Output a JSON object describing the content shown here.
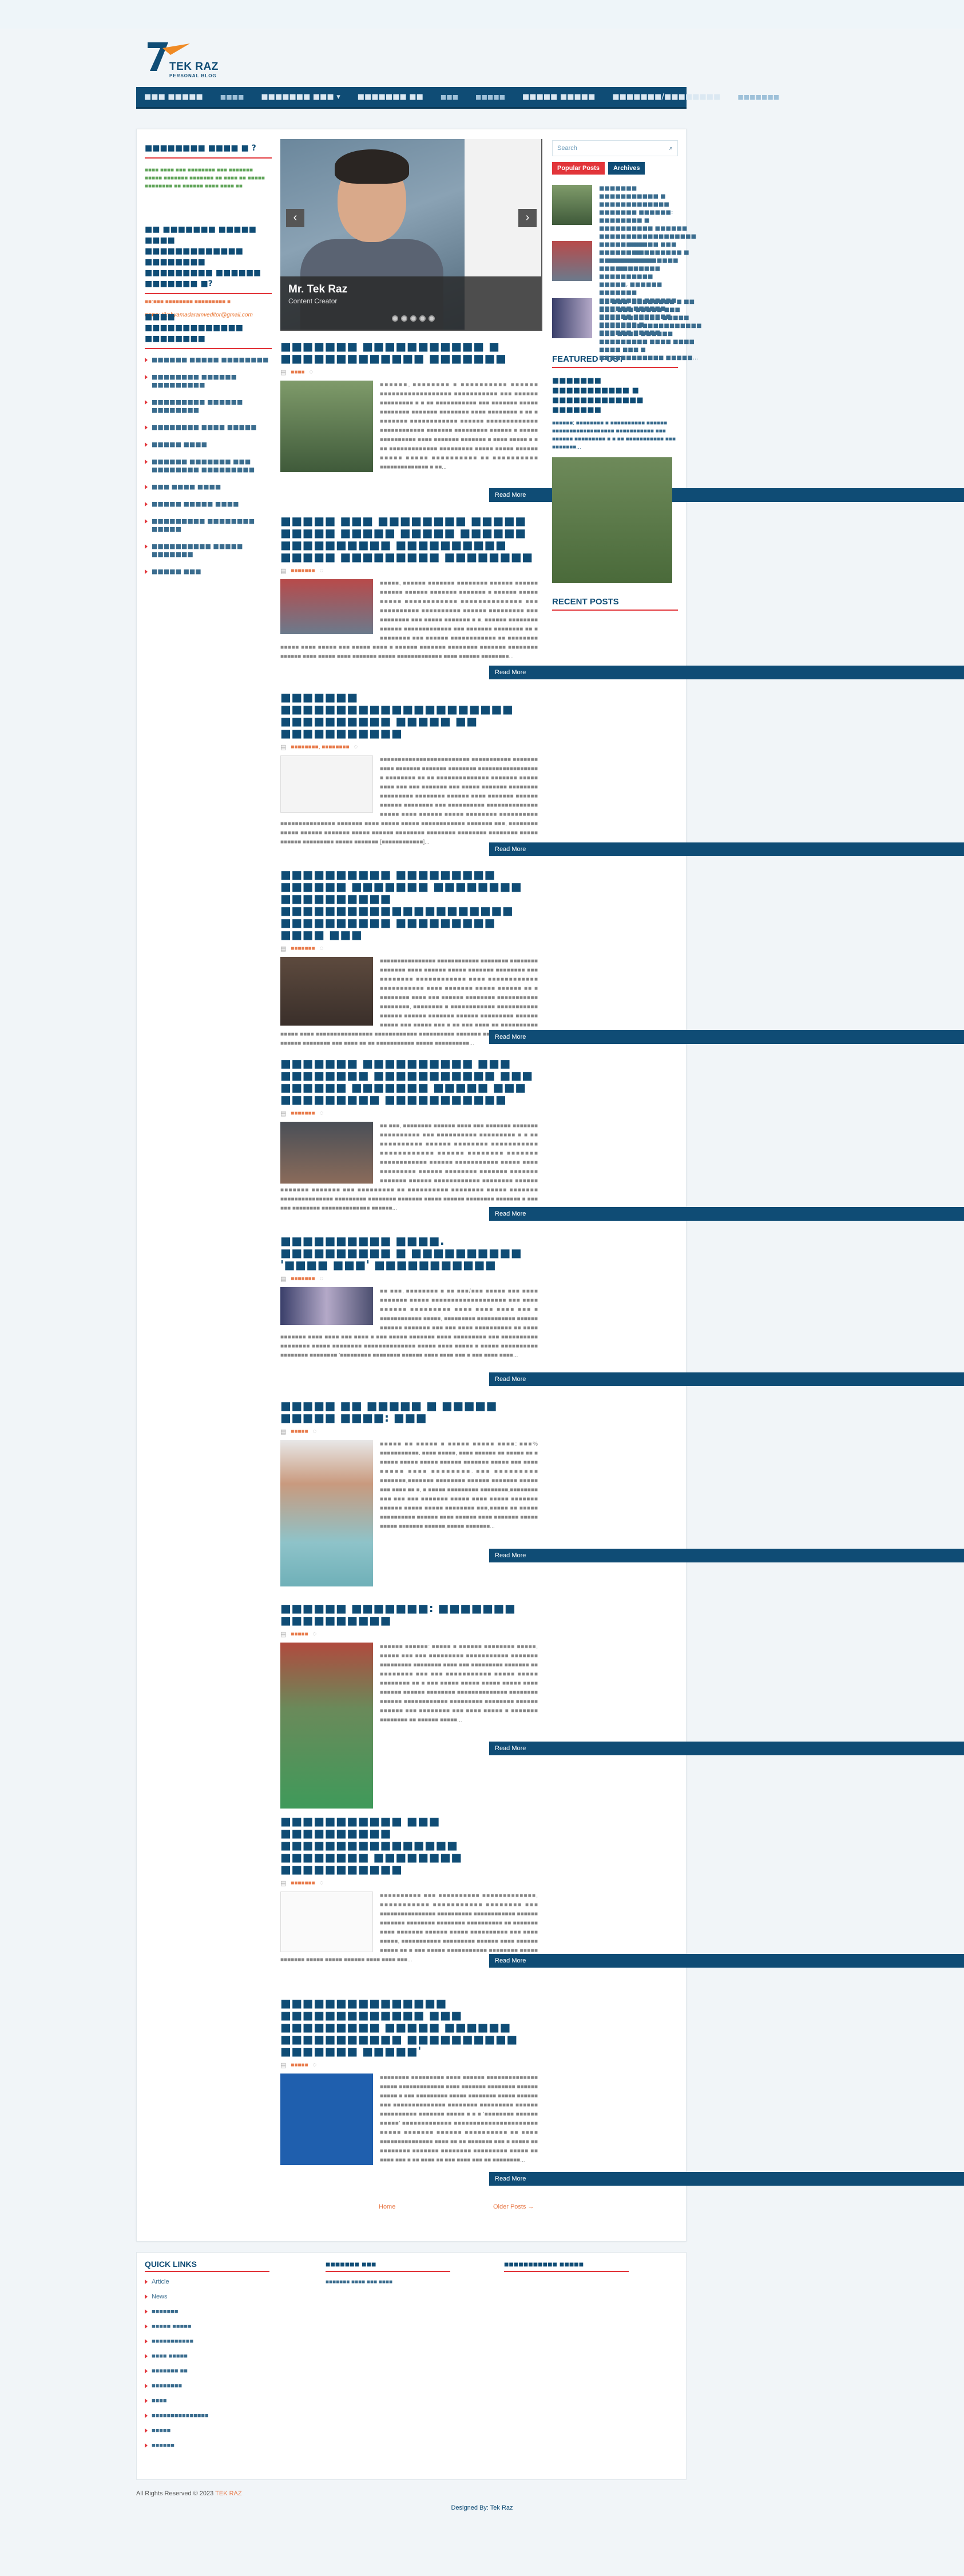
{
  "header": {
    "brand": "TEK RAZ",
    "tagline": "PERSONAL BLOG"
  },
  "nav": {
    "items": [
      "■■■ ■■■■■",
      "■■■■",
      "■■■■■■■ ■■■ ▾",
      "■■■■■■■ ■■",
      "■■■",
      "■■■■■",
      "■■■■■ ■■■■■",
      "■■■■■■■/■■■■■■■■",
      "■■■■■■■"
    ]
  },
  "left_sidebar": {
    "about_title": "■■■■■■■■ ■■■■ ■ ?",
    "about_text": "■■■■ ■■■■ ■■■ ■■■■■■■■ ■■■ ■■■■■■■ ■■■■■ ■■■■■■■ ■■■■■■■ ■■ ■■■■ ■■ ■■■■■ ■■■■■■■■ ■■ ■■■■■■ ■■■■ ■■■■ ■■",
    "contact_title": "■■ ■■■■■■■ ■■■■■ ■■■■ ■■■■■■■■■■■■■ ■■■■■■■■ ■■■■■■■■■ ■■■■■■ ■■■■■■■ ■?",
    "contact_phone": "■■:■■■ ■■■■■■■■ ■■■■■■■■■ ■",
    "contact_email": "■■■■: tikshyamadaramveditor@gmail.com",
    "categories_title": "■■■■ ■■■■■■■■■■■■■ ■■■■■■■■",
    "categories": [
      "■■■■■■ ■■■■■ ■■■■■■■■",
      "■■■■■■■■ ■■■■■■ ■■■■■■■■■",
      "■■■■■■■■■ ■■■■■■ ■■■■■■■■",
      "■■■■■■■■ ■■■■ ■■■■■",
      "■■■■■ ■■■■",
      "■■■■■■ ■■■■■■■ ■■■ ■■■■■■■■ ■■■■■■■■■",
      "■■■ ■■■■ ■■■■",
      "■■■■■ ■■■■■ ■■■■",
      "■■■■■■■■■ ■■■■■■■■ ■■■■■",
      "■■■■■■■■■■ ■■■■■ ■■■■■■■",
      "■■■■■ ■■■"
    ]
  },
  "slider": {
    "title": "Mr. Tek Raz",
    "subtitle": "Content Creator"
  },
  "posts": [
    {
      "title": "■■■■■■■ ■■■■■■■■■■■ ■ ■■■■■■■■■■■■■ ■■■■■■■",
      "cat": "■■■■",
      "text": "■■■■■■, ■■■■■■■■ ■ ■■■■■■■■■■ ■■■■■■ ■■■■■■■■■■■■■■■■■■ ■■■■■■■■■■■ ■■■ ■■■■■■ ■■■■■■■■■ ■ ■ ■■ ■■■■■■■■■■■ ■■■ ■■■■■■■ ■■■■■ ■■■■■■■■ ■■■■■■■ ■■■■■■■■ ■■■■ ■■■■■■■■ ■ ■■ ■ ■■■■■■■ ■■■■■■■■■■■■ ■■■■■■ ■■■■■■■■■■■■■ ■■■■■■■■■■■■ ■■■■■■■ ■■■■■■■■■ ■■■■■■ ■ ■■■■■ ■■■■■■■■■■ ■■■■ ■■■■■■■ ■■■■■■■ ■ ■■■■ ■■■■■ ■ ■ ■■ ■■■■■■■■■■■■■ ■■■■■■■■■ ■■■■■ ■■■■■ ■■■■■■ ■■■■■ ■■■■■ ■■■■■■■■■■ ■■ ■■■■■■■■■■ ■■■■■■■■■■■■■■ ■ ■■...",
      "read_more": "Read More"
    },
    {
      "title": "■■■■■ ■■■ ■■■■■■■■ ■■■■■ ■■■■■ ■■■■■ ■■■■■ ■■■■■■ ■■■■■■■■■■ ■■■■■■■■■■ ■■■■■ ■■■■■■■■■ ■■■■■■■■",
      "cat": "■■■■■■■",
      "text": "■■■■■, ■■■■■■ ■■■■■■■ ■■■■■■■■ ■■■■■■ ■■■■■■ ■■■■■■ ■■■■■■ ■■■■■■■ ■■■■■■■ ■ ■■■■■■ ■■■■■ ■■■■■ ■■■■■■■■■■■■ ■■■■■■■■■■■■■■ ■■■ ■■■■■■■■■■ ■■■■■■■■■■ ■■■■■■ ■■■■■■■■■ ■■■ ■■■■■■■■ ■■■ ■■■■■ ■■■■■■■ ■ ■. ■■■■■■ ■■■■■■■■ ■■■■■■ ■■■■■■■■■■■■■ ■■■ ■■■■■■■ ■■■■■■■■ ■■ ■ ■■■■■■■■ ■■■ ■■■■■■ ■■■■■■■■■■■■ ■■ ■■■■■■■■ ■■■■■ ■■■■ ■■■■■ ■■■ ■■■■■ ■■■■ ■ ■■■■■■ ■■■■■■■ ■■■■■■■■ ■■■■■■■ ■■■■■■■■ ■■■■■■ ■■■■ ■■■■■ ■■■■ ■■■■■■■ ■■■■■ ■■■■■■■■■■■■■ ■■■■ ■■■■■■ ■■■■■■■■...",
      "read_more": "Read More"
    },
    {
      "title": "■■■■■■■ ■■■■■■■■■■■■■■■■■■■■■ ■■■■■■■■■■ ■■■■■ ■■ ■■■■■■■■■■■",
      "cat": "■■■■■■■■, ■■■■■■■■",
      "text": "■■■■■■■■■■■■■■■■■■■■■■■■■ ■■■■■■■■■■■ ■■■■■■■ ■■■■ ■■■■■■■ ■■■■■■■ ■■■■■■■■ ■■■■■■■■■■■■■■■■■ ■ ■■■■■■■■ ■■ ■■ ■■■■■■■■■■■■■■ ■■■■■■■ ■■■■■ ■■■■ ■■■ ■■■ ■■■■■■■ ■■■ ■■■■■ ■■■■■■■ ■■■■■■■■ ■■■■■■■■■ ■■■■■■■■ ■■■■■■ ■■■■ ■■■■■■■ ■■■■■■ ■■■■■■ ■■■■■■■■ ■■■ ■■■■■■■■■■ ■■■■■■■■■■■■■■ ■■■■■ ■■■■ ■■■■■■ ■■■■■ ■■■■■■■■ ■■■■■■■■■■ ■■■■■■■■■■■■■■■ ■■■■■■■ ■■■■ ■■■■■ ■■■■■ ■■■■■■■■■■■■ ■■■■■■■ ■■■, ■■■■■■■■ ■■■■■ ■■■■■■ ■■■■■■■ ■■■■■ ■■■■■■ ■■■■■■■■ ■■■■■■■■ ■■■■■■■■ ■■■■■■■■ ■■■■■ ■■■■■■ ■■■■■■■■■ ■■■■■ ■■■■■■■ [■■■■■■■■■■■■]...",
      "read_more": "Read More"
    },
    {
      "title": "■■■■■■■■■■ ■■■■■■■■■ ■■■■■■ ■■■■■■■ ■■■■■■■■ ■■■■■■■■■■ ■■■■■■■■■■■■■■■■■■■■■ ■■■■■■■■■■ ■■■■■■■■■ ■■■■ ■■■",
      "cat": "■■■■■■■",
      "text": "■■■■■■■■■■■■■■■■ ■■■■■■■■■■■■ ■■■■■■■■ ■■■■■■■■ ■■■■■■■ ■■■■ ■■■■■■ ■■■■■ ■■■■■■■ ■■■■■■■■ ■■■ ■■■■■■■■ ■■■■■■■■■■■■ ■■■■ ■■■■■■■■■■■■ ■■■■■■■■■■■ ■■■■ ■■■■■■■ ■■■■■ ■■■■■■ ■■ ■ ■■■■■■■■ ■■■■ ■■■ ■■■■■■ ■■■■■■■■ ■■■■■■■■■■■ ■■■■■■■■, ■■■■■■■■ ■ ■■■■■■■■■■■■ ■■■■■■■■■■■ ■■■■■■ ■■■■■■ ■■■■■■■ ■■■■■■ ■■■■■■■■■ ■■■■■■ ■■■■■ ■■■ ■■■■■ ■■■ ■ ■■ ■■■ ■■■■ ■■ ■■■■■■■■■■ ■■■■■ ■■■■ ■■■■■■■■■■■■■■■■ ■■■■■■■■■■■■ ■■■■■■■■■■ ■■■■■■■ ■■■■■ ■■■■■■■■■■ ■■■■■■ ■■■■■■■■ ■■■ ■■■■ ■■ ■■ ■■■■■■■■■■■ ■■■■■ ■■■■■■■■■■...",
      "read_more": "Read More"
    },
    {
      "title": "■■■■■■■ ■■■■■■■■■■ ■■■ ■■■■■■■■ ■■■■■■■■■■■ ■■■ ■■■■■■ ■■■■■■■ ■■■■■ ■■■ ■■■■■■■■■ ■■■■■■■■■■■",
      "cat": "■■■■■■■",
      "text": "■■ ■■■, ■■■■■■■■ ■■■■■■ ■■■■ ■■■ ■■■■■■■ ■■■■■■■ ■■■■■■■■■■ ■■■ ■■■■■■■■■■ ■■■■■■■■■ ■ ■ ■■ ■■■■■■■■■■ ■■■■■■ ■■■■■■■■ ■■■■■■■■■■■ ■■■■■■■■■■■■ ■■■■■■ ■■■■■■■■ ■■■■■■■ ■■■■■■■■■■■■ ■■■■■■ ■■■■■■■■■■■ ■■■■■ ■■■■ ■■■■■■■■■ ■■■■■■ ■■■■■■■■ ■■■■■■■ ■■■■■■■ ■■■■■■■ ■■■■■■ ■■■■■■■■■■■■ ■■■■■■■■ ■■■■■■ ■■■■■■■ ■■■■■■■ ■■■ ■■■■■■■■■ ■■ ■■■■■■■■■■ ■■■■■■■■ ■■■■■ ■■■■■■■ ■■■■■■■■■■■■■■■ ■■■■■■■■■ ■■■■■■■■ ■■■■■■■ ■■■■■ ■■■■■■ ■■■■■■■■ ■■■■■■■ ■ ■■■ ■■■ ■■■■■■■■ ■■■■■■■■■■■■■■ ■■■■■■...",
      "read_more": "Read More"
    },
    {
      "title": "■■■■■■■■■■ ■■■■. ■■■■■■■■■■ ■ ■■■■■■■■■■ '■■■■ ■■■' ■■■■■■■■■■■",
      "cat": "■■■■■■■",
      "text": "■■ ■■■, ■■■■■■■■ ■ ■■ ■■■/■■■ ■■■■■ ■■■ ■■■■ ■■■■■■■ ■■■■■ ■■■■■■■■■■■■■■■■■■■ ■■■ ■■■■ ■■■■■■ ■■■■■■■■■ ■■■■ ■■■■ ■■■■ ■■■ ■ ■■■■■■■■■■■■ ■■■■■, ■■■■■■■■■ ■■■■■■■■■■■ ■■■■■■ ■■■■■■ ■■■■■■■ ■■■ ■■■ ■■■■ ■■■■■■■■■■ ■■ ■■■■ ■■■■■■■ ■■■■ ■■■■ ■■■ ■■■■ ■ ■■■ ■■■■■ ■■■■■■■ ■■■■ ■■■■■■■■■ ■■■ ■■■■■■■■■■ ■■■■■■■■ ■■■■■ ■■■■■■■■ ■■■■■■■■■■■■■■ ■■■■■ ■■■■ ■■■■■ ■ ■■■■■ ■■■■■■■■■■ ■■■■■■■■ ■■■■■■■■ '■■■■■■■■■ ■■■■■■■■ ■■■■■■ ■■■■ ■■■■ ■■■ ■ ■■■ ■■■■ ■■■■...",
      "read_more": "Read More"
    },
    {
      "title": "■■■■■ ■■ ■■■■■ ■ ■■■■■ ■■■■■ ■■■■: ■■■",
      "cat": "■■■■■",
      "text": "■■■■■ ■■ ■■■■■ ■ ■■■■■ ■■■■■ ■■■■: ■■■% ■■■■■■■■■■■. ■■■■ ■■■■■, ■■■■ ■■■■■■ ■■ ■■■■■ ■■ ■ ■■■■■ ■■■■■ ■■■■■ ■■■■■■ ■■■■■■■ ■■■■■ ■■■ ■■■■ ■■■■■ ■■■■ ■■■■■■■■. ■■■ ■■■■■■■■■ ■■■■■■■,■■■■■■■ ■■■■■■■■ ■■■■■■ ■■■■■■■ ■■■■■ ■■■ ■■■■ ■■ ■, ■ ■■■■■ ■■■■■■■■■ ■■■■■■■■,■■■■■■■■ ■■■ ■■■ ■■■ ■■■■■■■ ■■■■■ ■■■■ ■■■■■ ■■■■■■■ ■■■■■■ ■■■■■ ■■■■■ ■■■■■■■■ ■■■,■■■■■ ■■ ■■■■■ ■■■■■■■■■■ ■■■■■■ ■■■■ ■■■■■■ ■■■■ ■■■■■■■ ■■■■■ ■■■■■ ■■■■■■■ ■■■■■■,■■■■■ ■■■■■■■...",
      "read_more": "Read More"
    },
    {
      "title": "■■■■■■ ■■■■■■■: ■■■■■■■ ■■■■■■■■■■",
      "cat": "■■■■■",
      "text": "■■■■■■ ■■■■■■: ■■■■■ ■ ■■■■■■ ■■■■■■■■ ■■■■■, ■■■■■ ■■■ ■■■ ■■■■■■■■■ ■■■■■■■■■■■ ■■■■■■■ ■■■■■■■■■ ■■■■■■■■ ■■■■ ■■■ ■■■■■■■■■ ■■■■■■■ ■■ ■■■■■■■■ ■■■ ■■■ ■■■■■■■■■■■ ■■■■■ ■■■■■ ■■■■■■■■ ■■ ■ ■■■ ■■■■■ ■■■■■ ■■■■■ ■■■■■ ■■■■ ■■■■■■ ■■■■■■ ■■■■■■■■ ■■■■■■■■■■■■■■ ■■■■■■■■ ■■■■■■ ■■■■■■■■■■■■ ■■■■■■■■■ ■■■■■■■■ ■■■■■■ ■■■■■■ ■■■ ■■■■■■■■ ■■■ ■■■■ ■■■■■ ■ ■■■■■■■ ■■■■■■■■ ■■ ■■■■■■ ■■■■■...",
      "read_more": "Read More"
    },
    {
      "title": "■■■■■■■■■■■ ■■■ ■■■■■■■■■■ ■■■■■■■■■■■■■■■■ ■■■■■■■■ ■■■■■■■■ ■■■■■■■■■■■",
      "cat": "■■■■■■■",
      "text": "■■■■■■■■■■ ■■■ ■■■■■■■■■■ ■■■■■■■■■■■■■, ■■■■■■■■■■■ ■■■■■■■■■■■ ■■■■■■■■ ■■■ ■■■■■■■■■■■■■■■■ ■■■■■■■■■■ ■■■■■■■■■■■■ ■■■■■■ ■■■■■■■ ■■■■■■■■ ■■■■■■■■ ■■■■■■■■■■ ■■ ■■■■■■■ ■■■■ ■■■■■■■ ■■■■■■ ■■■■■ ■■■■■■■■■■ ■■■ ■■■■ ■■■■■, ■■■■■■■■■■■ ■■■■■■■■■ ■■■■■■ ■■■■ ■■■■■■ ■■■■■ ■■ ■ ■■■ ■■■■■ ■■■■■■■■■■■ ■■■■■■■■ ■■■■■ ■■■■■■■ ■■■■■ ■■■■■ ■■■■■■ ■■■■ ■■■■ ■■■...",
      "read_more": "Read More"
    },
    {
      "title": "■■■■■■■■■■■■■■■ ■■■■■■■■■■■■■ ■■■ ■■■■■■■■■ ■■■■■ ■■■■■■ ■■■■■■■■■■■ ■■■■■■■■■■ ■■■■■■■ ■■■■■'",
      "cat": "■■■■■",
      "text": "■■■■■■■■ ■■■■■■■■■ ■■■■ ■■■■■■ ■■■■■■■■■■■■■■ ■■■■■ ■■■■■■■■■■■■■ ■■■■ ■■■■■■■ ■■■■■■■■ ■■■■■■ ■■■■■ ■ ■■■ ■■■■■■■■■ ■■■■■ ■■■■■■■■ ■■■■■ ■■■■■■ ■■■ ■■■■■■■■■■■■■■ ■■■■■■■■ ■■■■■■■■■ ■■■■■■ ■■■■■■■■■■ ■■■■■■■ ■■■■■ ■ ■ ■ '■■■■■■■■ ■■■■■■ ■■■■■' ■■■■■■■■■■■■■ ■■■■■■■■■■■■■■■■■■■■■■ ■■■■■ ■■■■■■■ ■■■■■■ ■■■■■■■■■■ ■■ ■■■■ ■■■■■■■■■■■■■■■ ■■■■ ■■ ■■ ■■■■■■■ ■■■ ■ ■■■■■ ■■ ■■■■■■■■ ■■■■■■■ ■■■■■■■■ ■■■■■■■■■ ■■■■■ ■■ ■■■■ ■■■ ■ ■■ ■■■■ ■■ ■■■ ■■■■ ■■■ ■■ ■■■■■■■■...",
      "read_more": "Read More"
    }
  ],
  "pagination": {
    "home": "Home",
    "older": "Older Posts →"
  },
  "right_sidebar": {
    "search_placeholder": "Search",
    "tab_popular": "Popular Posts",
    "tab_archives": "Archives",
    "popular": [
      "■■■■■■■ ■■■■■■■■■■■ ■ ■■■■■■■■■■■■■ ■■■■■■■ ■■■■■■: ■■■■■■■■ ■ ■■■■■■■■■■ ■■■■■■ ■■■■■■■■■■■■■■■■■■ ■■■■■■■■■■■ ■■■ ■■■■■■ ■■■■■■■■■ ■ ■ ■■ ■■■■■■■■■■■ ■■■ ■■■■■...",
      "■■■■■ ■■■ ■■■■■■■■ ■■■■■ ■■■■■ ■■■■■ ■■■■■ ■■■■■■ ■■■■■■■■■■ ■■■■■, ■■■■■■ ■■■■■■■ ■■■■■■■■ ■■■■■■ ■■■■■■ ■■■■■■ ■■■■■■ ■■■■■■■ ■■■■■■■ ■ ■■■■■■ ■■■■■...",
      "■■ ■■■, ■■■■■■■■ ■ ■■ ■■■/■■■ ■■■■■ ■■■ ■■■■ ■■■■■■■ ■■■■■ ■■■■■■■■■■■■■■■■■■■ ■■■ ■■■■ ■■■■■■ ■■■■■■■■■ ■■■■ ■■■■ ■■■■ ■■■ ■ ■■■■■■■■■■■■ ■■■■■..."
    ],
    "featured_title": "FEATURED POST",
    "featured_post_title": "■■■■■■■ ■■■■■■■■■■■ ■ ■■■■■■■■■■■■■ ■■■■■■■",
    "featured_text": "■■■■■■: ■■■■■■■■ ■ ■■■■■■■■■■ ■■■■■■ ■■■■■■■■■■■■■■■■■■ ■■■■■■■■■■■ ■■■ ■■■■■■ ■■■■■■■■■ ■ ■ ■■ ■■■■■■■■■■■ ■■■ ■■■■■■■...",
    "recent_title": "RECENT POSTS"
  },
  "footer": {
    "quick_title": "QUICK LINKS",
    "quick_links": [
      "Article",
      "News",
      "■■■■■■■",
      "■■■■■ ■■■■■",
      "■■■■■■■■■■■",
      "■■■■ ■■■■■",
      "■■■■■■■ ■■",
      "■■■■■■■■",
      "■■■■",
      "■■■■■■■■■■■■■■■",
      "■■■■■",
      "■■■■■■"
    ],
    "col2_title": "■■■■■■■ ■■■",
    "col2_text": "■■■■■■■ ■■■■ ■■■ ■■■■",
    "col3_title": "■■■■■■■■■■■ ■■■■■",
    "copyright": "All Rights Reserved © 2023",
    "copyright_brand": "TEK RAZ",
    "designed_by": "Designed By: Tek Raz"
  },
  "colors": {
    "primary": "#0f4c75",
    "accent": "#e2353a",
    "orange": "#e87b4b",
    "green": "#62a55b"
  }
}
